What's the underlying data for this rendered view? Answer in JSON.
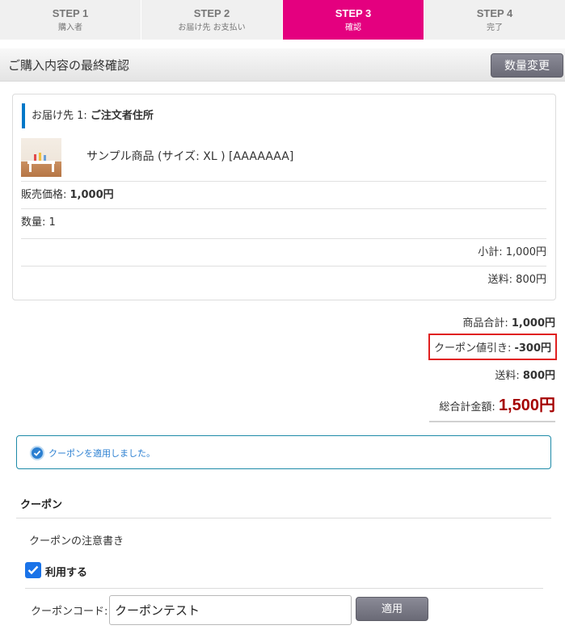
{
  "steps": [
    {
      "title": "STEP 1",
      "sub": "購入者",
      "active": false
    },
    {
      "title": "STEP 2",
      "sub": "お届け先 お支払い",
      "active": false
    },
    {
      "title": "STEP 3",
      "sub": "確認",
      "active": true
    },
    {
      "title": "STEP 4",
      "sub": "完了",
      "active": false
    }
  ],
  "header": {
    "title": "ご購入内容の最終確認",
    "qty_button": "数量変更"
  },
  "delivery": {
    "label_prefix": "お届け先 1: ",
    "label_name": "ご注文者住所",
    "product_name": "サンプル商品 (サイズ: XL ) [AAAAAAA]",
    "price_label": "販売価格: ",
    "price_value": "1,000円",
    "qty_text": "数量: 1",
    "subtotal_text": "小計: 1,000円",
    "shipping_text": "送料: 800円"
  },
  "totals": {
    "product_label": "商品合計: ",
    "product_value": "1,000円",
    "coupon_label": "クーポン値引き: ",
    "coupon_value": "-300円",
    "shipping_label": "送料: ",
    "shipping_value": "800円",
    "grand_label": "総合計金額: ",
    "grand_value": "1,500円"
  },
  "notice": {
    "text": "クーポンを適用しました。"
  },
  "coupon": {
    "title": "クーポン",
    "note": "クーポンの注意書き",
    "use_label": "利用する",
    "use_checked": true,
    "code_label": "クーポンコード:",
    "code_value": "クーポンテスト",
    "apply_label": "適用"
  },
  "colors": {
    "accent": "#e4007f",
    "grand_total": "#a50000",
    "highlight_border": "#e02020",
    "info": "#2b7fd1"
  }
}
